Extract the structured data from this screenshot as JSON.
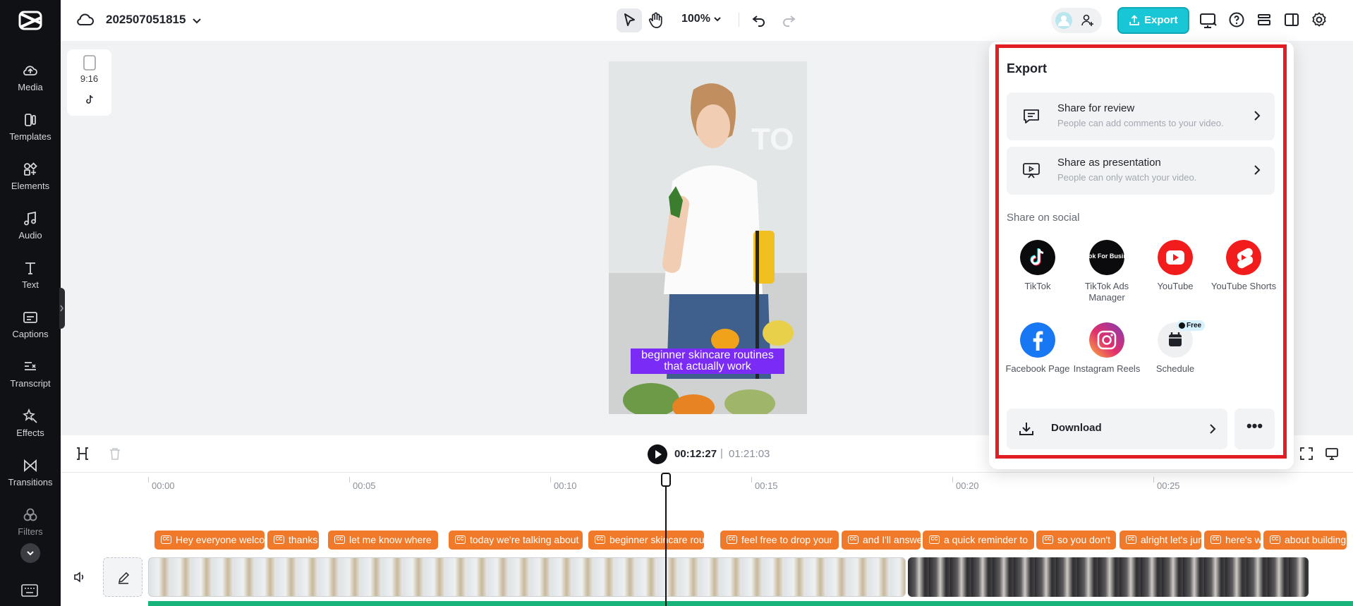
{
  "app": {
    "name": "CapCut"
  },
  "sidebar": {
    "items": [
      {
        "label": "Media",
        "icon": "cloud-upload-icon"
      },
      {
        "label": "Templates",
        "icon": "templates-icon"
      },
      {
        "label": "Elements",
        "icon": "elements-icon"
      },
      {
        "label": "Audio",
        "icon": "music-note-icon"
      },
      {
        "label": "Text",
        "icon": "text-icon"
      },
      {
        "label": "Captions",
        "icon": "captions-icon"
      },
      {
        "label": "Transcript",
        "icon": "transcript-icon"
      },
      {
        "label": "Effects",
        "icon": "effects-icon"
      },
      {
        "label": "Transitions",
        "icon": "transitions-icon"
      },
      {
        "label": "Filters",
        "icon": "filters-icon"
      }
    ]
  },
  "header": {
    "project_name": "202507051815",
    "zoom": "100%",
    "export_label": "Export",
    "accent_color": "#19c6d6"
  },
  "canvas": {
    "format_ratio": "9:16",
    "caption_text": "beginner skincare routines that actually work"
  },
  "playback": {
    "current_time": "00:12:27",
    "separator": "|",
    "total_time": "01:21:03"
  },
  "timeline": {
    "ruler": [
      "00:00",
      "00:05",
      "00:10",
      "00:15",
      "00:20",
      "00:25"
    ],
    "captions": [
      "Hey everyone welcome",
      "thanks",
      "let me know where",
      "today we're talking about",
      "beginner skincare routines",
      "feel free to drop your",
      "and I'll answer",
      "a quick reminder to",
      "so you don't",
      "alright let's jump",
      "here's what",
      "about building"
    ],
    "caption_color": "#f07a2a",
    "audio_color": "#17b37a"
  },
  "export_panel": {
    "title": "Export",
    "share_review": {
      "title": "Share for review",
      "subtitle": "People can add comments to your video."
    },
    "share_presentation": {
      "title": "Share as presentation",
      "subtitle": "People can only watch your video."
    },
    "social_section_label": "Share on social",
    "socials": [
      {
        "label": "TikTok",
        "icon": "tiktok-icon"
      },
      {
        "label": "TikTok Ads Manager",
        "icon": "tiktok-ads-icon",
        "badge_text": "TikTok For Business"
      },
      {
        "label": "YouTube",
        "icon": "youtube-icon"
      },
      {
        "label": "YouTube Shorts",
        "icon": "youtube-shorts-icon"
      },
      {
        "label": "Facebook Page",
        "icon": "facebook-icon"
      },
      {
        "label": "Instagram Reels",
        "icon": "instagram-icon"
      },
      {
        "label": "Schedule",
        "icon": "calendar-icon",
        "badge": "Free"
      }
    ],
    "download_label": "Download",
    "more_label": "•••",
    "highlight_color": "#e01e24"
  }
}
